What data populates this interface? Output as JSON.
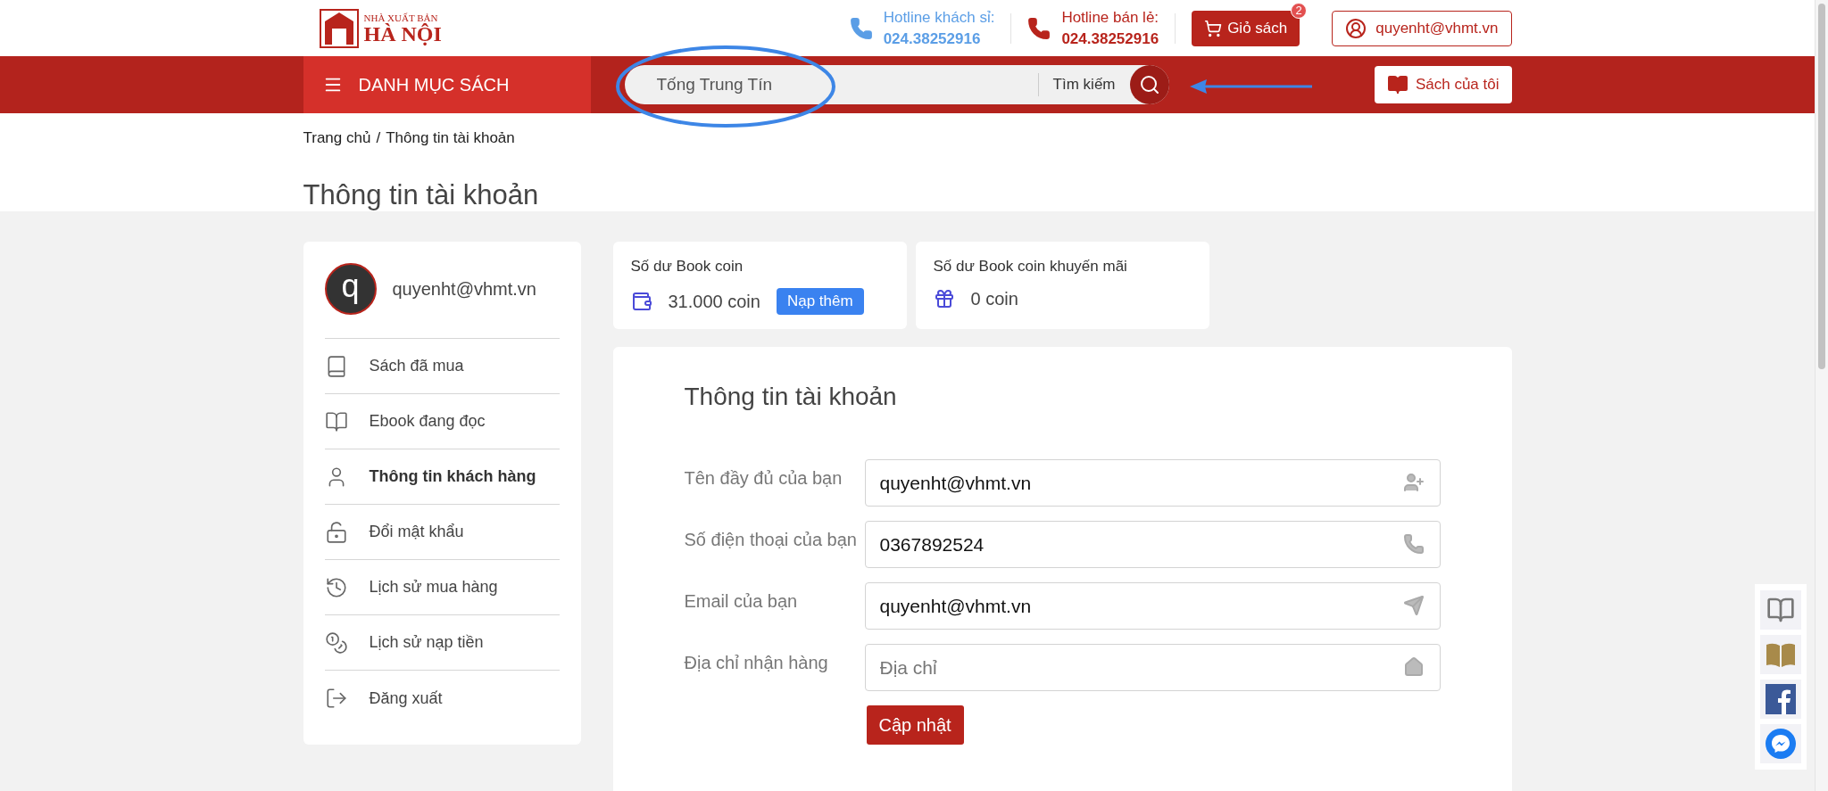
{
  "header": {
    "logo": {
      "top": "NHÀ XUẤT BẢN",
      "main": "HÀ NỘI"
    },
    "hotlines": [
      {
        "label": "Hotline khách sỉ:",
        "number": "024.38252916",
        "color": "#5b9ee6"
      },
      {
        "label": "Hotline bán lẻ:",
        "number": "024.38252916",
        "color": "#b8241c"
      }
    ],
    "cart": {
      "label": "Giỏ sách",
      "count": "2"
    },
    "account": {
      "email": "quyenht@vhmt.vn"
    }
  },
  "nav": {
    "menu_label": "DANH MỤC SÁCH",
    "search": {
      "value": "Tống Trung Tín",
      "button_label": "Tìm kiếm"
    },
    "my_books": "Sách của tôi"
  },
  "breadcrumb": {
    "items": [
      "Trang chủ",
      "Thông tin tài khoản"
    ],
    "separator": "/"
  },
  "page_title": "Thông tin tài khoản",
  "sidebar": {
    "avatar_letter": "q",
    "email": "quyenht@vhmt.vn",
    "items": [
      {
        "label": "Sách đã mua",
        "selected": false
      },
      {
        "label": "Ebook đang đọc",
        "selected": false
      },
      {
        "label": "Thông tin khách hàng",
        "selected": true
      },
      {
        "label": "Đổi mật khẩu",
        "selected": false
      },
      {
        "label": "Lịch sử mua hàng",
        "selected": false
      },
      {
        "label": "Lịch sử nạp tiền",
        "selected": false
      },
      {
        "label": "Đăng xuất",
        "selected": false
      }
    ]
  },
  "balances": [
    {
      "label": "Số dư Book coin",
      "amount": "31.000 coin",
      "action": "Nạp thêm"
    },
    {
      "label": "Số dư Book coin khuyến mãi",
      "amount": "0 coin"
    }
  ],
  "form": {
    "title": "Thông tin tài khoản",
    "fields": [
      {
        "label": "Tên đầy đủ của bạn",
        "value": "quyenht@vhmt.vn"
      },
      {
        "label": "Số điện thoại của bạn",
        "value": "0367892524"
      },
      {
        "label": "Email của bạn",
        "value": "quyenht@vhmt.vn"
      },
      {
        "label": "Địa chỉ nhận hàng",
        "placeholder": "Địa chỉ"
      }
    ],
    "submit": "Cập nhật"
  }
}
